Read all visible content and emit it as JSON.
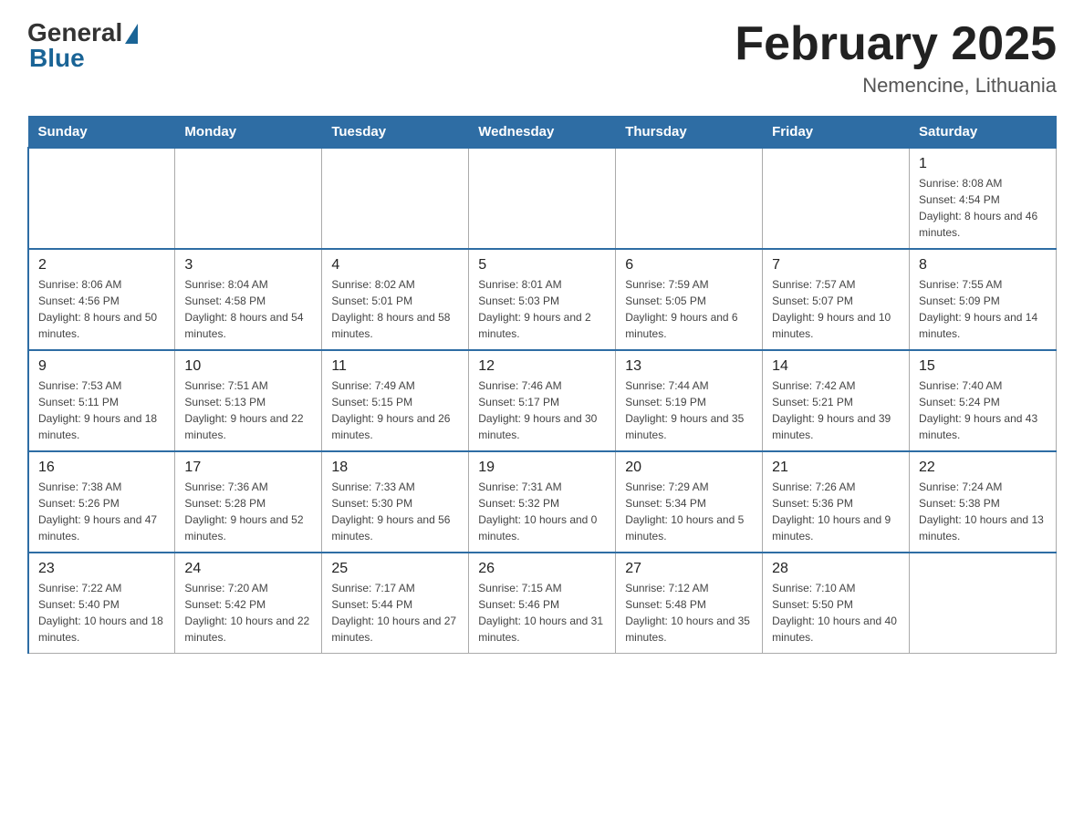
{
  "header": {
    "logo_general": "General",
    "logo_blue": "Blue",
    "title": "February 2025",
    "subtitle": "Nemencine, Lithuania"
  },
  "days_of_week": [
    "Sunday",
    "Monday",
    "Tuesday",
    "Wednesday",
    "Thursday",
    "Friday",
    "Saturday"
  ],
  "weeks": [
    [
      {
        "day": "",
        "info": ""
      },
      {
        "day": "",
        "info": ""
      },
      {
        "day": "",
        "info": ""
      },
      {
        "day": "",
        "info": ""
      },
      {
        "day": "",
        "info": ""
      },
      {
        "day": "",
        "info": ""
      },
      {
        "day": "1",
        "info": "Sunrise: 8:08 AM\nSunset: 4:54 PM\nDaylight: 8 hours and 46 minutes."
      }
    ],
    [
      {
        "day": "2",
        "info": "Sunrise: 8:06 AM\nSunset: 4:56 PM\nDaylight: 8 hours and 50 minutes."
      },
      {
        "day": "3",
        "info": "Sunrise: 8:04 AM\nSunset: 4:58 PM\nDaylight: 8 hours and 54 minutes."
      },
      {
        "day": "4",
        "info": "Sunrise: 8:02 AM\nSunset: 5:01 PM\nDaylight: 8 hours and 58 minutes."
      },
      {
        "day": "5",
        "info": "Sunrise: 8:01 AM\nSunset: 5:03 PM\nDaylight: 9 hours and 2 minutes."
      },
      {
        "day": "6",
        "info": "Sunrise: 7:59 AM\nSunset: 5:05 PM\nDaylight: 9 hours and 6 minutes."
      },
      {
        "day": "7",
        "info": "Sunrise: 7:57 AM\nSunset: 5:07 PM\nDaylight: 9 hours and 10 minutes."
      },
      {
        "day": "8",
        "info": "Sunrise: 7:55 AM\nSunset: 5:09 PM\nDaylight: 9 hours and 14 minutes."
      }
    ],
    [
      {
        "day": "9",
        "info": "Sunrise: 7:53 AM\nSunset: 5:11 PM\nDaylight: 9 hours and 18 minutes."
      },
      {
        "day": "10",
        "info": "Sunrise: 7:51 AM\nSunset: 5:13 PM\nDaylight: 9 hours and 22 minutes."
      },
      {
        "day": "11",
        "info": "Sunrise: 7:49 AM\nSunset: 5:15 PM\nDaylight: 9 hours and 26 minutes."
      },
      {
        "day": "12",
        "info": "Sunrise: 7:46 AM\nSunset: 5:17 PM\nDaylight: 9 hours and 30 minutes."
      },
      {
        "day": "13",
        "info": "Sunrise: 7:44 AM\nSunset: 5:19 PM\nDaylight: 9 hours and 35 minutes."
      },
      {
        "day": "14",
        "info": "Sunrise: 7:42 AM\nSunset: 5:21 PM\nDaylight: 9 hours and 39 minutes."
      },
      {
        "day": "15",
        "info": "Sunrise: 7:40 AM\nSunset: 5:24 PM\nDaylight: 9 hours and 43 minutes."
      }
    ],
    [
      {
        "day": "16",
        "info": "Sunrise: 7:38 AM\nSunset: 5:26 PM\nDaylight: 9 hours and 47 minutes."
      },
      {
        "day": "17",
        "info": "Sunrise: 7:36 AM\nSunset: 5:28 PM\nDaylight: 9 hours and 52 minutes."
      },
      {
        "day": "18",
        "info": "Sunrise: 7:33 AM\nSunset: 5:30 PM\nDaylight: 9 hours and 56 minutes."
      },
      {
        "day": "19",
        "info": "Sunrise: 7:31 AM\nSunset: 5:32 PM\nDaylight: 10 hours and 0 minutes."
      },
      {
        "day": "20",
        "info": "Sunrise: 7:29 AM\nSunset: 5:34 PM\nDaylight: 10 hours and 5 minutes."
      },
      {
        "day": "21",
        "info": "Sunrise: 7:26 AM\nSunset: 5:36 PM\nDaylight: 10 hours and 9 minutes."
      },
      {
        "day": "22",
        "info": "Sunrise: 7:24 AM\nSunset: 5:38 PM\nDaylight: 10 hours and 13 minutes."
      }
    ],
    [
      {
        "day": "23",
        "info": "Sunrise: 7:22 AM\nSunset: 5:40 PM\nDaylight: 10 hours and 18 minutes."
      },
      {
        "day": "24",
        "info": "Sunrise: 7:20 AM\nSunset: 5:42 PM\nDaylight: 10 hours and 22 minutes."
      },
      {
        "day": "25",
        "info": "Sunrise: 7:17 AM\nSunset: 5:44 PM\nDaylight: 10 hours and 27 minutes."
      },
      {
        "day": "26",
        "info": "Sunrise: 7:15 AM\nSunset: 5:46 PM\nDaylight: 10 hours and 31 minutes."
      },
      {
        "day": "27",
        "info": "Sunrise: 7:12 AM\nSunset: 5:48 PM\nDaylight: 10 hours and 35 minutes."
      },
      {
        "day": "28",
        "info": "Sunrise: 7:10 AM\nSunset: 5:50 PM\nDaylight: 10 hours and 40 minutes."
      },
      {
        "day": "",
        "info": ""
      }
    ]
  ]
}
